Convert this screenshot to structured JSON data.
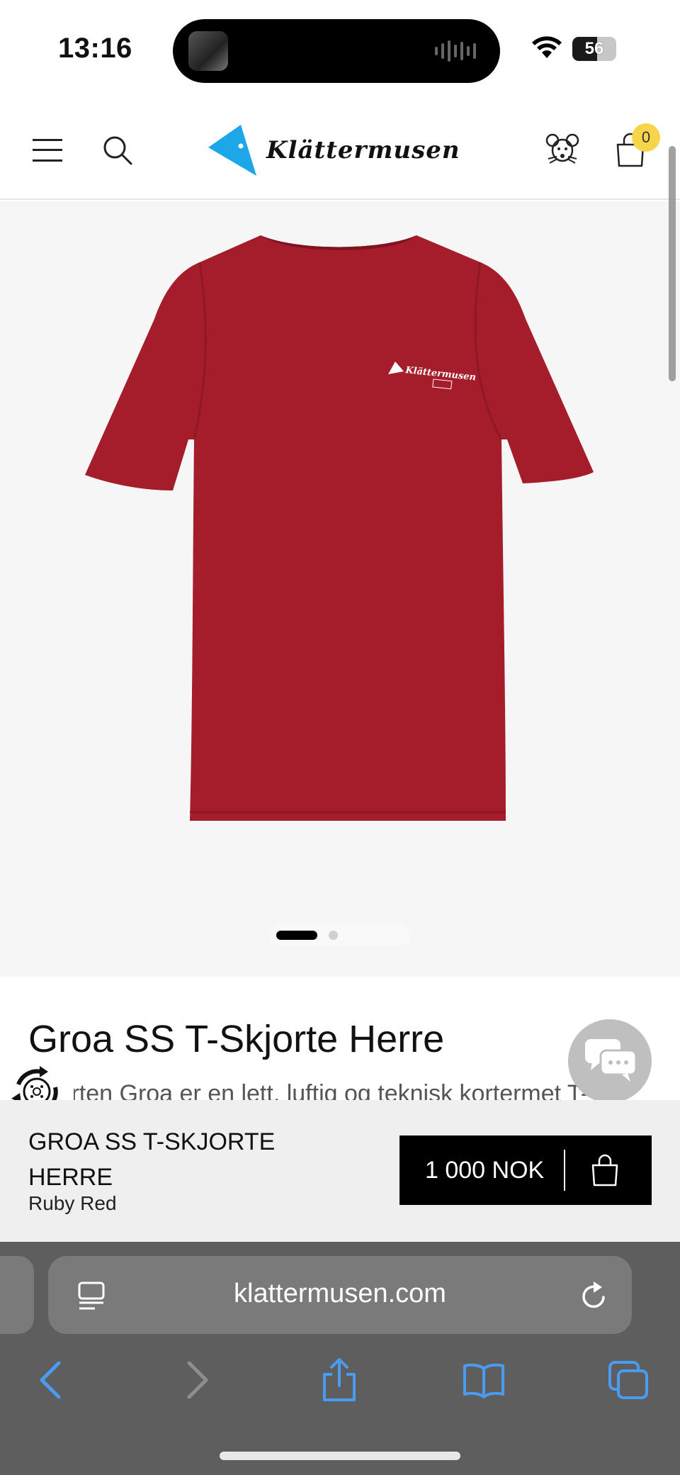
{
  "status_bar": {
    "time": "13:16",
    "battery_level": "56",
    "battery_fraction": 0.56
  },
  "header": {
    "logo_text": "Klättermusen",
    "cart_count": "0",
    "menu_icon": "hamburger-menu-icon",
    "search_icon": "search-icon",
    "account_icon": "mouse-account-icon",
    "cart_icon": "shopping-bag-icon",
    "brand_color": "#1ea7e8"
  },
  "product": {
    "title": "Groa SS T-Skjorte Herre",
    "description_partial": "…jorten Groa er en lett, luftig og teknisk kortermet T-",
    "image_colors": {
      "shirt": "#a51c2a",
      "background": "#f6f6f6"
    },
    "carousel": {
      "total_slides": 2,
      "active_slide": 1
    }
  },
  "buy_bar": {
    "name": "GROA SS T-SKJORTE HERRE",
    "color": "Ruby Red",
    "price": "1 000 NOK"
  },
  "browser": {
    "url": "klattermusen.com",
    "accent_color": "#4a9cf2"
  }
}
